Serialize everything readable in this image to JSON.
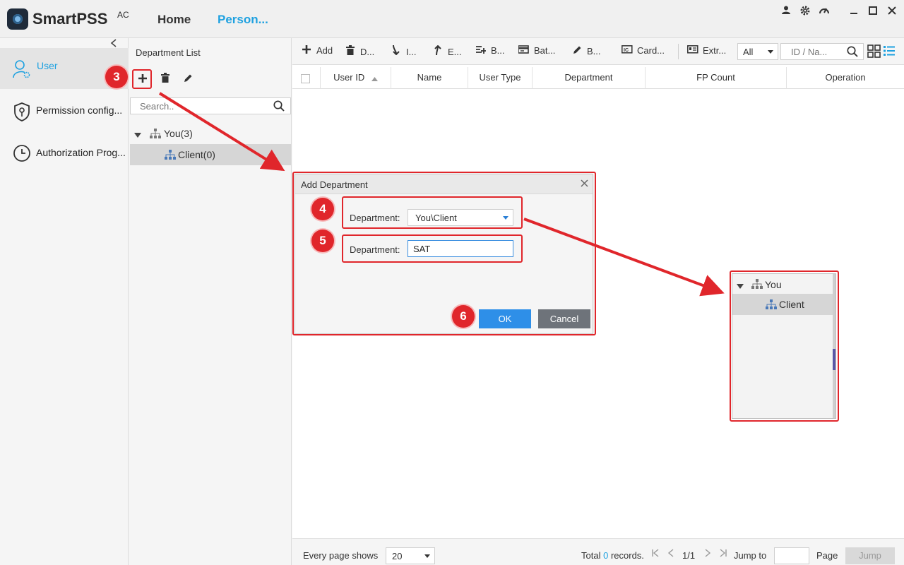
{
  "app": {
    "name": "SmartPSS",
    "superscript": "AC"
  },
  "nav": {
    "home": "Home",
    "person": "Person..."
  },
  "sidebar": {
    "items": [
      {
        "label": "User",
        "icon": "user-gear-icon"
      },
      {
        "label": "Permission config...",
        "icon": "shield-key-icon"
      },
      {
        "label": "Authorization Prog...",
        "icon": "clock-icon"
      }
    ]
  },
  "department": {
    "title": "Department List",
    "search_placeholder": "Search..",
    "tree": [
      {
        "label": "You(3)"
      },
      {
        "label": "Client(0)"
      }
    ]
  },
  "toolbar": {
    "items": [
      {
        "label": "Add",
        "icon": "plus-icon"
      },
      {
        "label": "D...",
        "icon": "trash-icon"
      },
      {
        "label": "I...",
        "icon": "import-icon"
      },
      {
        "label": "E...",
        "icon": "export-icon"
      },
      {
        "label": "B...",
        "icon": "batch-add-icon"
      },
      {
        "label": "Bat...",
        "icon": "card-batch-icon"
      },
      {
        "label": "B...",
        "icon": "pen-icon"
      },
      {
        "label": "Card...",
        "icon": "card-reader-icon"
      },
      {
        "label": "Extr...",
        "icon": "extract-icon"
      }
    ],
    "filter_value": "All",
    "search_placeholder": "ID / Na..."
  },
  "table": {
    "columns": [
      "User ID",
      "Name",
      "User Type",
      "Department",
      "FP Count",
      "Operation"
    ],
    "rows": []
  },
  "footer": {
    "every_page_shows": "Every page shows",
    "page_size": "20",
    "total_prefix": "Total",
    "total_count": "0",
    "total_suffix": "records.",
    "page_indicator": "1/1",
    "jump_to": "Jump to",
    "page": "Page",
    "jump_button": "Jump"
  },
  "dialog": {
    "title": "Add Department",
    "parent_label": "Department:",
    "parent_value": "You\\Client",
    "name_label": "Department:",
    "name_value": "SAT",
    "ok": "OK",
    "cancel": "Cancel"
  },
  "annotations": {
    "steps": [
      "3",
      "4",
      "5",
      "6"
    ],
    "color": "#e0262b"
  },
  "inset_tree": [
    {
      "label": "You"
    },
    {
      "label": "Client"
    }
  ]
}
